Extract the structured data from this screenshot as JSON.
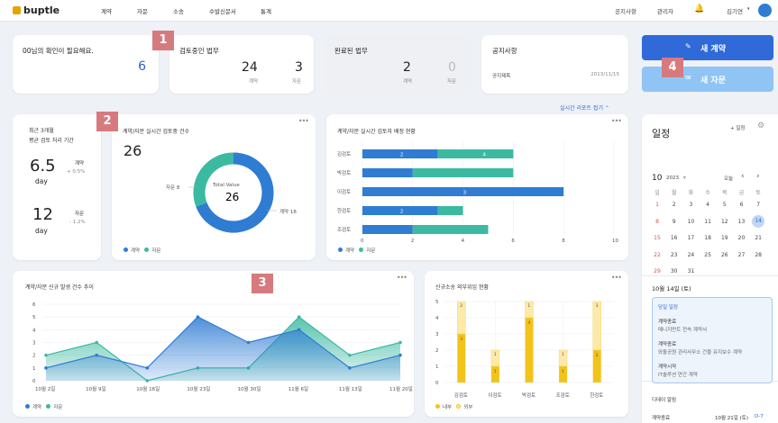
{
  "brand": {
    "name": "buptle",
    "accent": "#2f7cd3",
    "teal": "#3bbaa1",
    "yellow": "#f3c31a"
  },
  "nav": {
    "items": [
      "계약",
      "자문",
      "소송",
      "수발신문서",
      "통계"
    ]
  },
  "topright": {
    "notice": "공지사항",
    "admin": "관리자",
    "user": "김기연"
  },
  "summary": {
    "confirm": {
      "title": "00님의 확인이 필요해요.",
      "value": "6"
    },
    "reviewing": {
      "title": "검토중인 법무",
      "contract": "24",
      "advice": "3",
      "contract_label": "계약",
      "advice_label": "자문"
    },
    "done": {
      "title": "완료된 법무",
      "contract": "2",
      "advice": "0",
      "contract_label": "계약",
      "advice_label": "자문"
    },
    "notice": {
      "title": "공지사항",
      "item": "공지제목",
      "date": "2013/11/15"
    }
  },
  "buttons": {
    "new_contract": "새 계약",
    "new_advice": "새 자문"
  },
  "report_link": "실시간 리포트 접기",
  "marks": [
    "1",
    "2",
    "3",
    "4"
  ],
  "avg": {
    "title1": "최근 3개월",
    "title2": "평균 검토 처리 기간",
    "c_value": "6.5",
    "c_unit": "day",
    "c_label": "계약",
    "c_delta": "+ 0.5%",
    "a_value": "12",
    "a_unit": "day",
    "a_label": "자문",
    "a_delta": "- 1.2%"
  },
  "donut_card": {
    "title": "계약/자문 실시간 검토중 건수",
    "total": "26",
    "center_label": "Total Value",
    "center_value": "26",
    "advice_label": "자문 8",
    "contract_label": "계약 18",
    "legend": [
      "계약",
      "자문"
    ]
  },
  "assign_card": {
    "title": "계약/자문 실시간 검토자 배정 현황",
    "legend": [
      "계약",
      "자문"
    ]
  },
  "trend_card": {
    "title": "계약/자문 신규 발생 건수 추이",
    "legend": [
      "계약",
      "자문"
    ]
  },
  "lit_card": {
    "title": "신규소송 외부위임 현황",
    "legend": [
      "내부",
      "외부"
    ]
  },
  "schedule": {
    "title": "일정",
    "add_label": "+ 일정",
    "month": "10",
    "year": "2023",
    "today_btn": "오늘",
    "weekdays": [
      "일",
      "월",
      "화",
      "수",
      "목",
      "금",
      "토"
    ],
    "weeks": [
      [
        "1",
        "2",
        "3",
        "4",
        "5",
        "6",
        "7"
      ],
      [
        "8",
        "9",
        "10",
        "11",
        "12",
        "13",
        "14"
      ],
      [
        "15",
        "16",
        "17",
        "18",
        "19",
        "20",
        "21"
      ],
      [
        "22",
        "23",
        "24",
        "25",
        "26",
        "27",
        "28"
      ],
      [
        "29",
        "30",
        "31",
        "",
        "",
        "",
        "",
        ""
      ]
    ],
    "selected_date": "10월 14일 (토)",
    "box_title": "당일 일정",
    "events": [
      {
        "label": "계약종료",
        "desc": "매니지먼트 전속 계약서"
      },
      {
        "label": "계약종료",
        "desc": "와돌공원 관리사무소 건물 유지보수 계약"
      },
      {
        "label": "계약시작",
        "desc": "IT솔루션 연간 계약"
      }
    ],
    "dday_title": "디데이 알림",
    "dday_label": "계약종료",
    "dday_date": "10월 21일 (토)",
    "dday_badge": "D-7"
  },
  "chart_data": [
    {
      "type": "pie",
      "title": "계약/자문 실시간 검토중 건수",
      "series": [
        {
          "name": "계약",
          "values": [
            18
          ]
        },
        {
          "name": "자문",
          "values": [
            8
          ]
        }
      ],
      "categories": [
        "계약",
        "자문"
      ],
      "values": [
        18,
        8
      ]
    },
    {
      "type": "bar",
      "title": "계약/자문 실시간 검토자 배정 현황",
      "categories": [
        "김검토",
        "박검토",
        "이검토",
        "한검토",
        "조검토"
      ],
      "series": [
        {
          "name": "계약",
          "values": [
            3,
            2,
            8,
            3,
            2
          ]
        },
        {
          "name": "자문",
          "values": [
            3,
            4,
            0,
            1,
            3
          ]
        }
      ],
      "data_labels": [
        [
          "2",
          "4"
        ],
        [
          "",
          ""
        ],
        [
          "3",
          "1"
        ],
        [
          "2",
          ""
        ],
        [
          "",
          ""
        ]
      ],
      "xticks": [
        "0",
        "2",
        "4",
        "6",
        "8",
        "10"
      ],
      "xlim": [
        0,
        10
      ]
    },
    {
      "type": "area",
      "title": "계약/자문 신규 발생 건수 추이",
      "categories": [
        "10월 2일",
        "10월 9일",
        "10월 16일",
        "10월 23일",
        "10월 30일",
        "11월 6일",
        "11월 13일",
        "11월 20일"
      ],
      "series": [
        {
          "name": "계약",
          "values": [
            1,
            2,
            1,
            5,
            3,
            4,
            1,
            2
          ]
        },
        {
          "name": "자문",
          "values": [
            2,
            3,
            0,
            1,
            1,
            5,
            2,
            3
          ]
        }
      ],
      "yticks": [
        "0",
        "1",
        "2",
        "3",
        "4",
        "5",
        "6"
      ],
      "ylim": [
        0,
        6
      ]
    },
    {
      "type": "bar",
      "title": "신규소송 외부위임 현황",
      "categories": [
        "김검토",
        "이검토",
        "박검토",
        "조검토",
        "한검토"
      ],
      "series": [
        {
          "name": "내부",
          "values": [
            3,
            1,
            4,
            1,
            2
          ]
        },
        {
          "name": "외부",
          "values": [
            2,
            1,
            1,
            1,
            3
          ]
        }
      ],
      "data_labels": [
        [
          "3",
          "2"
        ],
        [
          "1",
          "1"
        ],
        [
          "4",
          "1"
        ],
        [
          "1",
          "1"
        ],
        [
          "2",
          "3"
        ]
      ],
      "yticks": [
        "0",
        "1",
        "2",
        "3",
        "4",
        "5"
      ],
      "ylim": [
        0,
        5
      ]
    }
  ]
}
